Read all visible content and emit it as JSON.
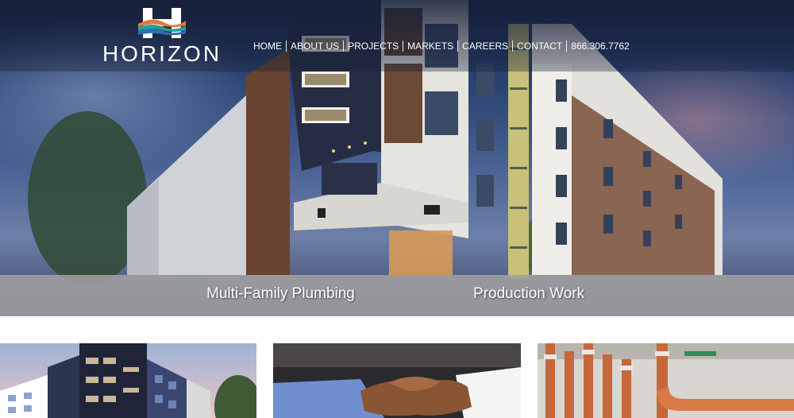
{
  "brand": {
    "name": "HORIZON"
  },
  "nav": {
    "items": [
      {
        "label": "HOME"
      },
      {
        "label": "ABOUT US"
      },
      {
        "label": "PROJECTS"
      },
      {
        "label": "MARKETS"
      },
      {
        "label": "CAREERS"
      },
      {
        "label": "CONTACT"
      },
      {
        "label": "866.306.7762"
      }
    ]
  },
  "banner": {
    "left_label": "Multi-Family Plumbing",
    "right_label": "Production Work"
  },
  "colors": {
    "banner_bg": "#a0a0a0",
    "logo_blue": "#2a6fb5",
    "logo_orange": "#e07a3c",
    "logo_teal": "#2a9d9a"
  }
}
